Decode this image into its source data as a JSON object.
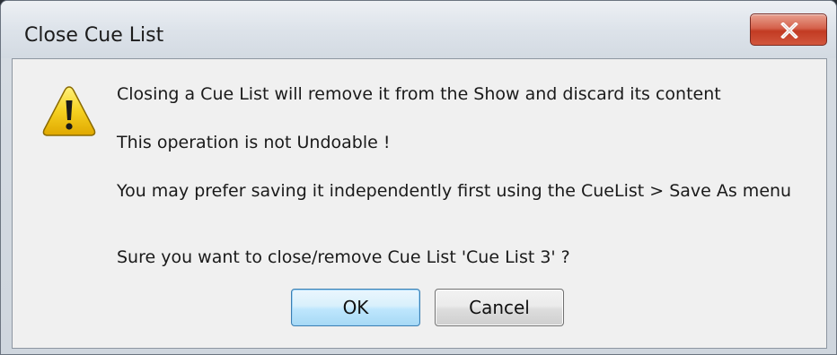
{
  "window": {
    "title": "Close Cue List"
  },
  "dialog": {
    "icon": "warning-icon",
    "lines": [
      "Closing a Cue List will remove it from the Show and discard its content",
      "This operation is not Undoable !",
      "You may prefer saving it independently first using the CueList > Save As menu",
      "Sure you want to close/remove Cue List 'Cue List 3' ?"
    ]
  },
  "buttons": {
    "ok_label": "OK",
    "cancel_label": "Cancel"
  },
  "colors": {
    "close_button": "#c23b23",
    "ok_border": "#3c7fb1",
    "warning_yellow": "#f5d020"
  }
}
